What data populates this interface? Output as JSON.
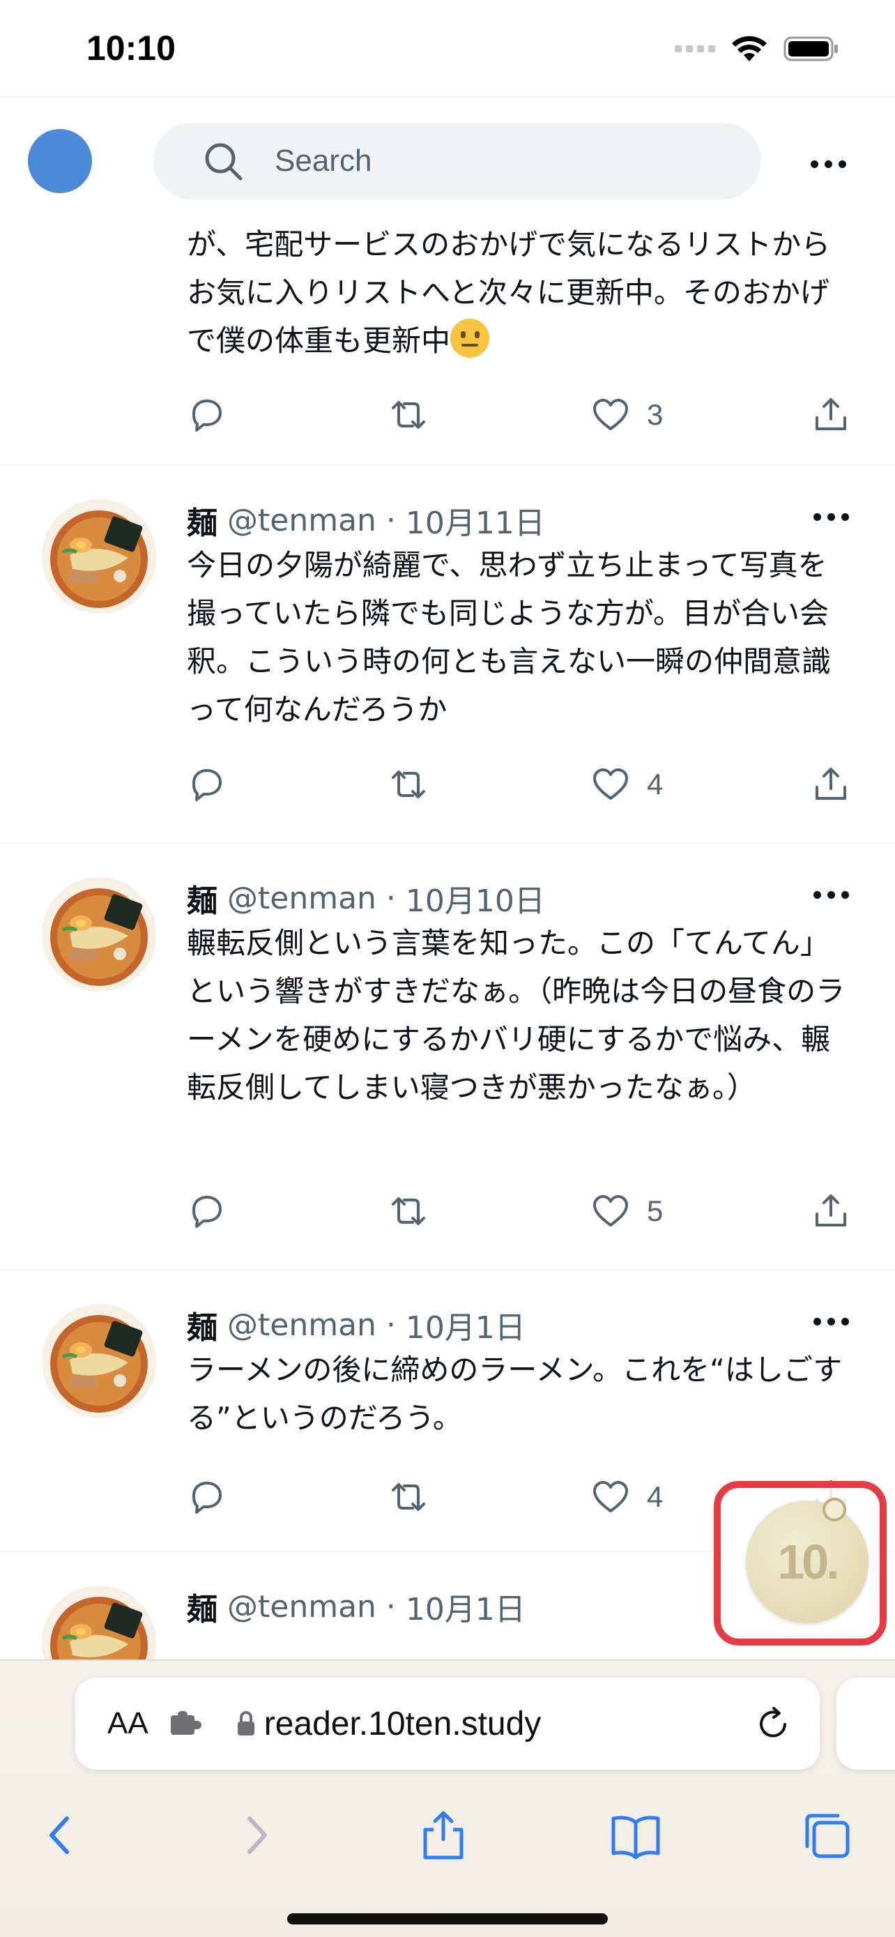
{
  "status_bar": {
    "time": "10:10"
  },
  "header": {
    "search_placeholder": "Search"
  },
  "tweets": [
    {
      "text": "が、宅配サービスのおかげで気になるリストからお気に入りリストへと次々に更新中。そのおかげで僕の体重も更新中",
      "emoji": "neutral-face-emoji",
      "likes": "3"
    },
    {
      "name": "麺",
      "handle": "@tenman",
      "sep": "·",
      "date": "10月11日",
      "text": "今日の夕陽が綺麗で、思わず立ち止まって写真を撮っていたら隣でも同じような方が。目が合い会釈。こういう時の何とも言えない一瞬の仲間意識って何なんだろうか",
      "likes": "4"
    },
    {
      "name": "麺",
      "handle": "@tenman",
      "sep": "·",
      "date": "10月10日",
      "text": "輾転反側という言葉を知った。この「てんてん」という響きがすきだなぁ。（昨晩は今日の昼食のラーメンを硬めにするかバリ硬にするかで悩み、輾転反側してしまい寝つきが悪かったなぁ。）",
      "likes": "5"
    },
    {
      "name": "麺",
      "handle": "@tenman",
      "sep": "·",
      "date": "10月1日",
      "text": "ラーメンの後に締めのラーメン。これを“はしごする”というのだろう。",
      "likes": "4"
    },
    {
      "name": "麺",
      "handle": "@tenman",
      "sep": "·",
      "date": "10月1日"
    }
  ],
  "extension_badge": {
    "label": "10."
  },
  "browser": {
    "text_size_label": "AA",
    "url": "reader.10ten.study"
  },
  "colors": {
    "accent": "#1d9bf0",
    "safari_blue": "#2f7cf6",
    "badge_border": "#e63a45"
  }
}
